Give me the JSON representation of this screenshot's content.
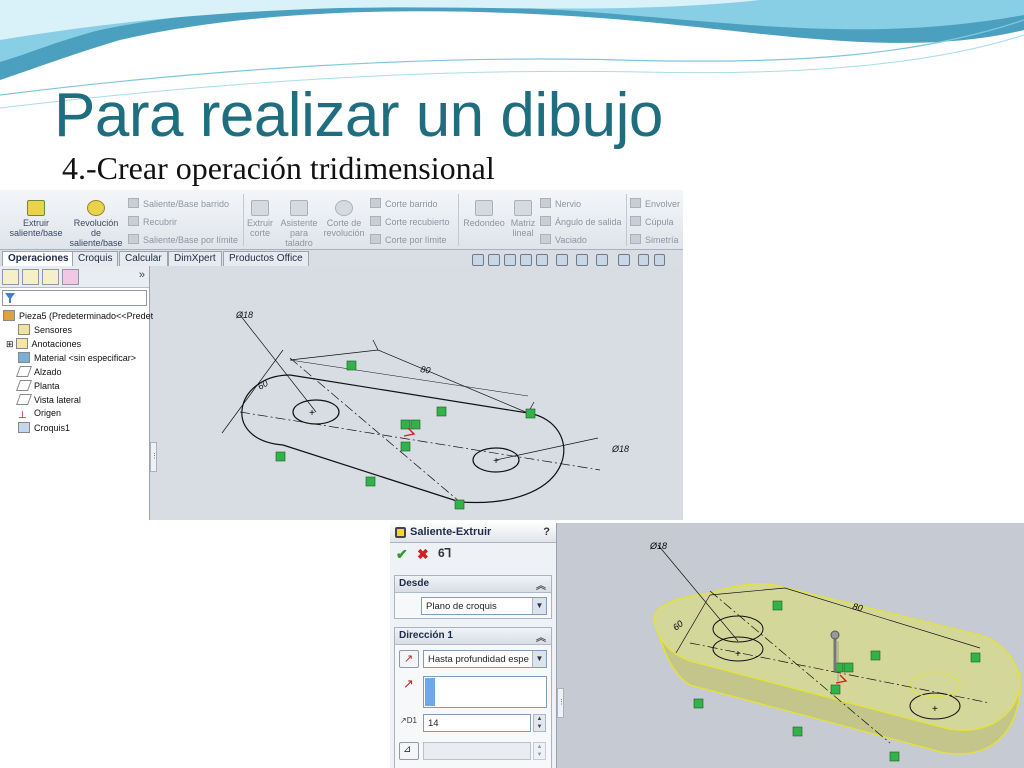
{
  "slide": {
    "title": "Para realizar un dibujo",
    "subtitle": "4.-Crear  operación tridimensional"
  },
  "colors": {
    "title": "#1f6e80",
    "wave_dark": "#2a8fb3",
    "wave_light": "#8fd3e8",
    "extrude_fill": "#d4d79a",
    "extrude_edge": "#e3e23a",
    "relation_green": "#33b24a"
  },
  "ribbon": {
    "extruir": "Extruir saliente/base",
    "revolucion": "Revolución de saliente/base",
    "saliente_barrido": "Saliente/Base barrido",
    "recubrir": "Recubrir",
    "saliente_limite": "Saliente/Base por límite",
    "extruir_corte": "Extruir corte",
    "asistente": "Asistente para taladro",
    "corte_revolucion": "Corte de revolución",
    "corte_barrido": "Corte barrido",
    "corte_recubierto": "Corte recubierto",
    "corte_limite": "Corte por límite",
    "redondeo": "Redondeo",
    "matriz": "Matriz lineal",
    "nervio": "Nervio",
    "angulo": "Ángulo de salida",
    "vaciado": "Vaciado",
    "envolver": "Envolver",
    "cupula": "Cúpula",
    "simetria": "Simetría"
  },
  "tabs": [
    "Operaciones",
    "Croquis",
    "Calcular",
    "DimXpert",
    "Productos Office"
  ],
  "tree": {
    "root": "Pieza5  (Predeterminado<<Predet",
    "items": [
      "Sensores",
      "Anotaciones",
      "Material <sin especificar>",
      "Alzado",
      "Planta",
      "Vista lateral",
      "Origen",
      "Croquis1"
    ]
  },
  "sketch": {
    "dim_dia1": "Ø18",
    "dim_80": "80",
    "dim_60": "60",
    "dim_dia2": "Ø18"
  },
  "property_manager": {
    "title": "Saliente-Extruir",
    "help": "?",
    "desde_header": "Desde",
    "desde_value": "Plano de croquis",
    "direccion_header": "Dirección 1",
    "direccion_value": "Hasta profundidad espe",
    "depth_value": "14",
    "depth_label": "D1"
  },
  "model": {
    "dim_dia": "Ø18",
    "dim_80": "80",
    "dim_60": "60"
  }
}
